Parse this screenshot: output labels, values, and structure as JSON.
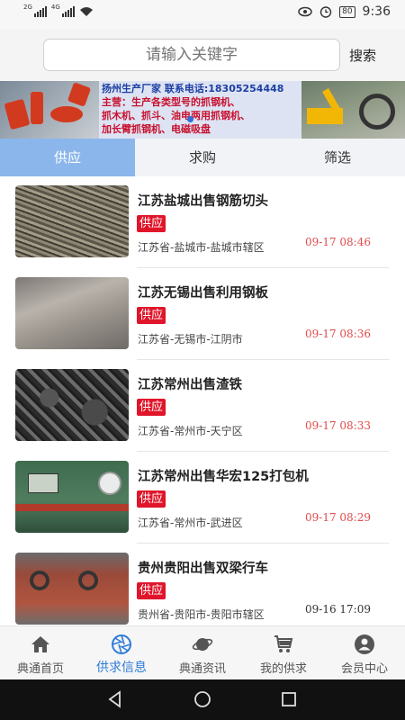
{
  "status_bar": {
    "left_tag_1": "2G",
    "left_tag_2": "4G",
    "battery": "80",
    "time": "9:36"
  },
  "search": {
    "placeholder": "请输入关键字",
    "button_label": "搜索"
  },
  "banner": {
    "line1": "扬州生产厂家 联系电话:18305254448",
    "line2": "主营：生产各类型号的抓钢机、",
    "line3": "抓木机、抓斗、油电两用抓钢机、",
    "line4": "加长臂抓钢机、电磁吸盘"
  },
  "tabs": [
    {
      "label": "供应",
      "active": true
    },
    {
      "label": "求购",
      "active": false
    },
    {
      "label": "筛选",
      "active": false
    }
  ],
  "listings": [
    {
      "title": "江苏盐城出售钢筋切头",
      "badge": "供应",
      "location": "江苏省-盐城市-盐城市辖区",
      "time": "09-17 08:46"
    },
    {
      "title": "江苏无锡出售利用钢板",
      "badge": "供应",
      "location": "江苏省-无锡市-江阴市",
      "time": "09-17 08:36"
    },
    {
      "title": "江苏常州出售渣铁",
      "badge": "供应",
      "location": "江苏省-常州市-天宁区",
      "time": "09-17 08:33"
    },
    {
      "title": "江苏常州出售华宏125打包机",
      "badge": "供应",
      "location": "江苏省-常州市-武进区",
      "time": "09-17 08:29"
    },
    {
      "title": "贵州贵阳出售双梁行车",
      "badge": "供应",
      "location": "贵州省-贵阳市-贵阳市辖区",
      "time": "09-16 17:09"
    }
  ],
  "bottom_nav": [
    {
      "label": "典通首页",
      "icon": "home-icon"
    },
    {
      "label": "供求信息",
      "icon": "aperture-icon",
      "active": true
    },
    {
      "label": "典通资讯",
      "icon": "planet-icon"
    },
    {
      "label": "我的供求",
      "icon": "cart-icon"
    },
    {
      "label": "会员中心",
      "icon": "user-icon"
    }
  ],
  "colors": {
    "accent": "#2e7bd6",
    "tab_active": "#8bb6ec",
    "badge": "#e0152a",
    "time": "#e24a4a"
  }
}
